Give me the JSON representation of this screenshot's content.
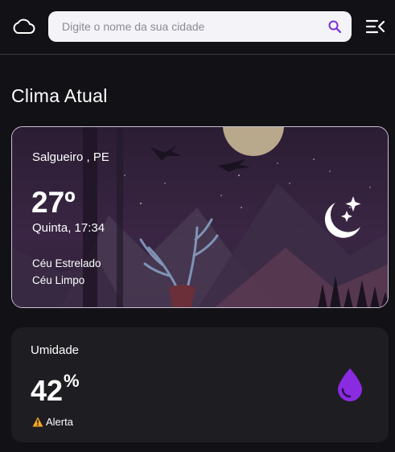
{
  "header": {
    "logo_icon": "cloud-icon",
    "search": {
      "placeholder": "Digite o nome da sua cidade",
      "value": "",
      "icon": "search-icon"
    },
    "menu_icon": "menu-collapse-icon"
  },
  "section_title": "Clima Atual",
  "current": {
    "city": "Salgueiro , PE",
    "temperature": "27º",
    "datetime": "Quinta, 17:34",
    "condition_1": "Céu Estrelado",
    "condition_2": "Céu Limpo",
    "icon": "moon-stars-icon"
  },
  "humidity": {
    "title": "Umidade",
    "value": "42",
    "unit": "%",
    "alert": "Alerta",
    "alert_icon": "warning-icon",
    "icon": "water-drop-icon"
  },
  "colors": {
    "background": "#121116",
    "card": "#1e1d22",
    "accent": "#8a2be2",
    "warning": "#f5a623"
  }
}
